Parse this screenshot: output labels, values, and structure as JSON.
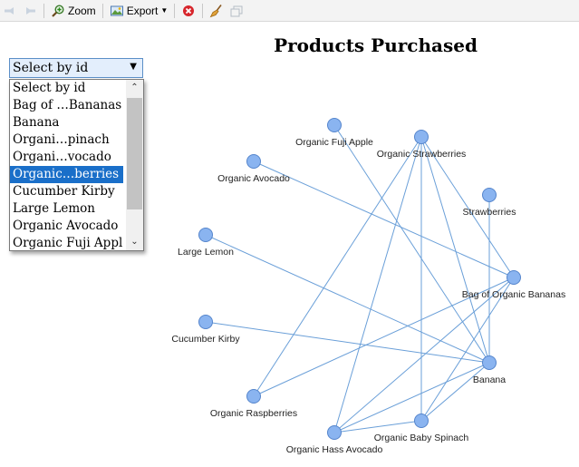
{
  "toolbar": {
    "zoom_label": "Zoom",
    "export_label": "Export"
  },
  "chart": {
    "title": "Products Purchased"
  },
  "select": {
    "value": "Select by id",
    "options": [
      "Select by id",
      "Bag of …Bananas",
      "Banana",
      "Organi…pinach",
      "Organi…vocado",
      "Organic…berries",
      "Cucumber Kirby",
      "Large Lemon",
      "Organic Avocado",
      "Organic Fuji Apple"
    ],
    "selected_option": "Organic…berries"
  },
  "colors": {
    "node_fill": "#8ab4f0",
    "node_stroke": "#5585cc",
    "edge": "#6a9fd8",
    "selected_bg": "#1a6fc9"
  },
  "graph": {
    "nodes": [
      {
        "id": "fuji",
        "label": "Organic Fuji Apple"
      },
      {
        "id": "straw_org",
        "label": "Organic Strawberries"
      },
      {
        "id": "avocado",
        "label": "Organic Avocado"
      },
      {
        "id": "strawberries",
        "label": "Strawberries"
      },
      {
        "id": "lemon",
        "label": "Large Lemon"
      },
      {
        "id": "bag_bananas",
        "label": "Bag of Organic Bananas"
      },
      {
        "id": "cucumber",
        "label": "Cucumber Kirby"
      },
      {
        "id": "banana",
        "label": "Banana"
      },
      {
        "id": "raspberries",
        "label": "Organic Raspberries"
      },
      {
        "id": "spinach",
        "label": "Organic Baby Spinach"
      },
      {
        "id": "hass",
        "label": "Organic Hass Avocado"
      }
    ],
    "edges": [
      [
        "fuji",
        "banana"
      ],
      [
        "avocado",
        "bag_bananas"
      ],
      [
        "lemon",
        "banana"
      ],
      [
        "cucumber",
        "banana"
      ],
      [
        "straw_org",
        "banana"
      ],
      [
        "straw_org",
        "bag_bananas"
      ],
      [
        "straw_org",
        "spinach"
      ],
      [
        "straw_org",
        "hass"
      ],
      [
        "straw_org",
        "raspberries"
      ],
      [
        "strawberries",
        "banana"
      ],
      [
        "bag_bananas",
        "raspberries"
      ],
      [
        "bag_bananas",
        "spinach"
      ],
      [
        "bag_bananas",
        "hass"
      ],
      [
        "banana",
        "spinach"
      ],
      [
        "banana",
        "hass"
      ],
      [
        "hass",
        "spinach"
      ]
    ]
  }
}
